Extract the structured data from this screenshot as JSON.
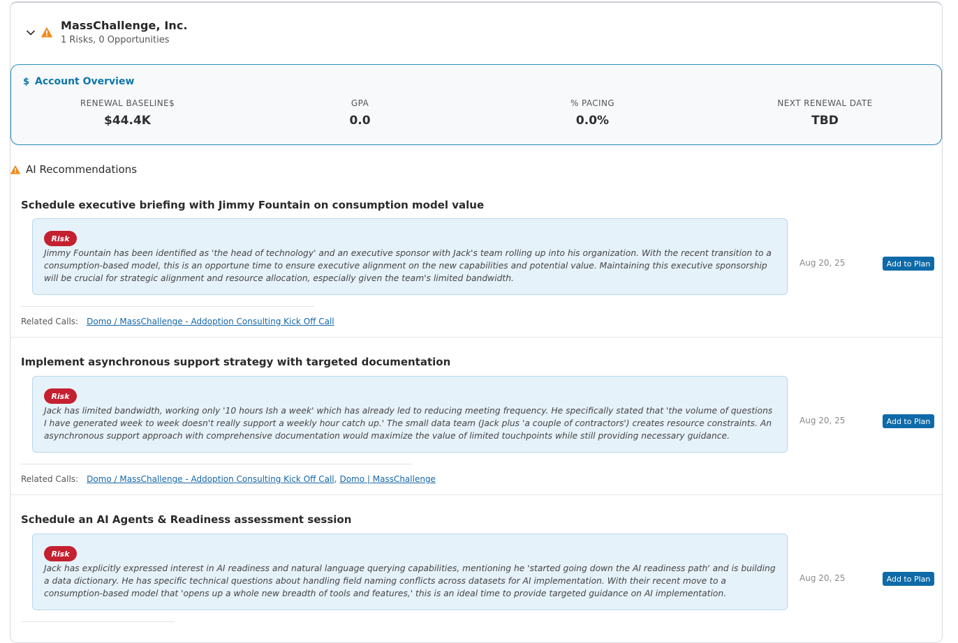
{
  "account": {
    "name": "MassChallenge, Inc.",
    "summary": "1 Risks, 0 Opportunities"
  },
  "overview": {
    "icon": "dollar-icon",
    "title": "Account Overview",
    "stats": [
      {
        "label": "RENEWAL BASELINE$",
        "value": "$44.4K"
      },
      {
        "label": "GPA",
        "value": "0.0"
      },
      {
        "label": "% PACING",
        "value": "0.0%"
      },
      {
        "label": "NEXT RENEWAL DATE",
        "value": "TBD"
      }
    ]
  },
  "ai_section": {
    "icon": "warning-icon",
    "title": "AI Recommendations"
  },
  "recommendations": [
    {
      "title": "Schedule executive briefing with Jimmy Fountain on consumption model value",
      "badge": "Risk",
      "body": "Jimmy Fountain has been identified as 'the head of technology' and an executive sponsor with Jack's team rolling up into his organization. With the recent transition to a consumption-based model, this is an opportune time to ensure executive alignment on the new capabilities and potential value. Maintaining this executive sponsorship will be crucial for strategic alignment and resource allocation, especially given the team's limited bandwidth.",
      "date": "Aug 20, 25",
      "button": "Add to Plan",
      "calls_label": "Related Calls:",
      "calls": [
        "Domo / MassChallenge - Addoption Consulting Kick Off Call"
      ]
    },
    {
      "title": "Implement asynchronous support strategy with targeted documentation",
      "badge": "Risk",
      "body": "Jack has limited bandwidth, working only '10 hours Ish a week' which has already led to reducing meeting frequency. He specifically stated that 'the volume of questions I have generated week to week doesn't really support a weekly hour catch up.' The small data team (Jack plus 'a couple of contractors') creates resource constraints. An asynchronous support approach with comprehensive documentation would maximize the value of limited touchpoints while still providing necessary guidance.",
      "date": "Aug 20, 25",
      "button": "Add to Plan",
      "calls_label": "Related Calls:",
      "calls": [
        "Domo / MassChallenge - Addoption Consulting Kick Off Call",
        "Domo | MassChallenge"
      ]
    },
    {
      "title": "Schedule an AI Agents & Readiness assessment session",
      "badge": "Risk",
      "body": "Jack has explicitly expressed interest in AI readiness and natural language querying capabilities, mentioning he 'started going down the AI readiness path' and is building a data dictionary. He has specific technical questions about handling field naming conflicts across datasets for AI implementation. With their recent move to a consumption-based model that 'opens up a whole new breadth of tools and features,' this is an ideal time to provide targeted guidance on AI implementation.",
      "date": "Aug 20, 25",
      "button": "Add to Plan",
      "calls_label": "",
      "calls": []
    }
  ],
  "colors": {
    "accent": "#0f76a8",
    "risk": "#c4202f",
    "warning": "#f08a1c",
    "button": "#0e6aa8",
    "box_bg": "#e6f2fa"
  }
}
